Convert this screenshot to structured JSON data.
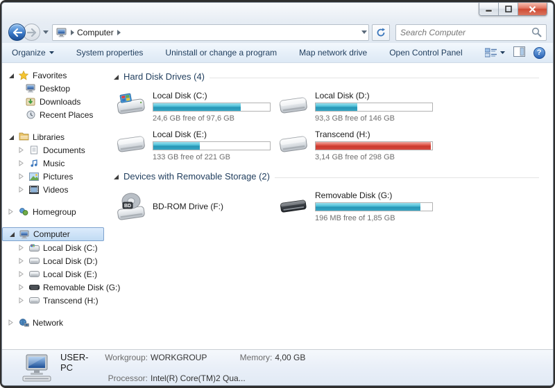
{
  "navbar": {
    "breadcrumb": {
      "location": "Computer"
    },
    "search": {
      "placeholder": "Search Computer"
    }
  },
  "toolbar": {
    "organize": "Organize",
    "items": [
      "System properties",
      "Uninstall or change a program",
      "Map network drive",
      "Open Control Panel"
    ]
  },
  "sidebar": {
    "groups": [
      {
        "label": "Favorites",
        "children": [
          "Desktop",
          "Downloads",
          "Recent Places"
        ]
      },
      {
        "label": "Libraries",
        "children": [
          "Documents",
          "Music",
          "Pictures",
          "Videos"
        ]
      },
      {
        "label": "Homegroup",
        "children": []
      },
      {
        "label": "Computer",
        "children": [
          "Local Disk (C:)",
          "Local Disk (D:)",
          "Local Disk (E:)",
          "Removable Disk (G:)",
          "Transcend (H:)"
        ]
      },
      {
        "label": "Network",
        "children": []
      }
    ]
  },
  "main": {
    "sections": [
      {
        "title": "Hard Disk Drives (4)",
        "drives": [
          {
            "name": "Local Disk (C:)",
            "caption": "24,6 GB free of 97,6 GB",
            "used_pct": 75,
            "bar_color": "teal"
          },
          {
            "name": "Local Disk (D:)",
            "caption": "93,3 GB free of 146 GB",
            "used_pct": 36,
            "bar_color": "teal"
          },
          {
            "name": "Local Disk (E:)",
            "caption": "133 GB free of 221 GB",
            "used_pct": 40,
            "bar_color": "teal"
          },
          {
            "name": "Transcend (H:)",
            "caption": "3,14 GB free of 298 GB",
            "used_pct": 99,
            "bar_color": "red"
          }
        ]
      },
      {
        "title": "Devices with Removable Storage (2)",
        "drives": [
          {
            "name": "BD-ROM Drive (F:)"
          },
          {
            "name": "Removable Disk (G:)",
            "caption": "196 MB free of 1,85 GB",
            "used_pct": 90,
            "bar_color": "teal"
          }
        ]
      }
    ]
  },
  "statusbar": {
    "computer_name": "USER-PC",
    "workgroup_label": "Workgroup:",
    "workgroup_value": "WORKGROUP",
    "memory_label": "Memory:",
    "memory_value": "4,00 GB",
    "processor_label": "Processor:",
    "processor_value": "Intel(R) Core(TM)2 Qua..."
  },
  "icons": {
    "help_glyph": "?",
    "bd_badge": "BD"
  },
  "colors": {
    "bar_teal": "#35a7c6",
    "bar_red": "#d84840",
    "selection_border": "#7da2ce",
    "header_text": "#1e3c5c"
  }
}
